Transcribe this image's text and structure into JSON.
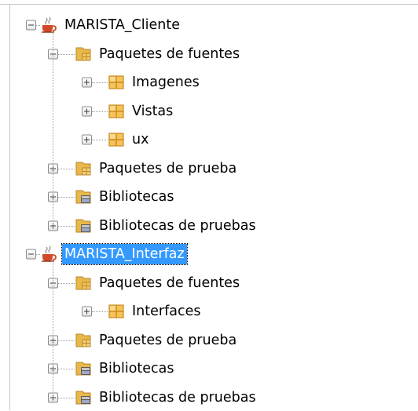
{
  "tree": {
    "projects": [
      {
        "label": "MARISTA_Cliente",
        "selected": false,
        "expanded": true,
        "children": [
          {
            "label": "Paquetes de fuentes",
            "icon": "source-packages-folder-icon",
            "expanded": true,
            "children": [
              {
                "label": "Imagenes",
                "icon": "package-icon"
              },
              {
                "label": "Vistas",
                "icon": "package-icon"
              },
              {
                "label": "ux",
                "icon": "package-icon"
              }
            ]
          },
          {
            "label": "Paquetes de prueba",
            "icon": "test-packages-folder-icon",
            "expanded": false
          },
          {
            "label": "Bibliotecas",
            "icon": "libraries-folder-icon",
            "expanded": false
          },
          {
            "label": "Bibliotecas de pruebas",
            "icon": "libraries-folder-icon",
            "expanded": false
          }
        ]
      },
      {
        "label": "MARISTA_Interfaz",
        "selected": true,
        "expanded": true,
        "children": [
          {
            "label": "Paquetes de fuentes",
            "icon": "source-packages-folder-icon",
            "expanded": true,
            "children": [
              {
                "label": "Interfaces",
                "icon": "package-icon"
              }
            ]
          },
          {
            "label": "Paquetes de prueba",
            "icon": "test-packages-folder-icon",
            "expanded": false
          },
          {
            "label": "Bibliotecas",
            "icon": "libraries-folder-icon",
            "expanded": false
          },
          {
            "label": "Bibliotecas de pruebas",
            "icon": "libraries-folder-icon",
            "expanded": false
          }
        ]
      }
    ]
  },
  "colors": {
    "selection": "#3399ff",
    "folder": "#e8b84a",
    "package": "#f2b24a",
    "coffee_cup": "#d04a2a"
  }
}
